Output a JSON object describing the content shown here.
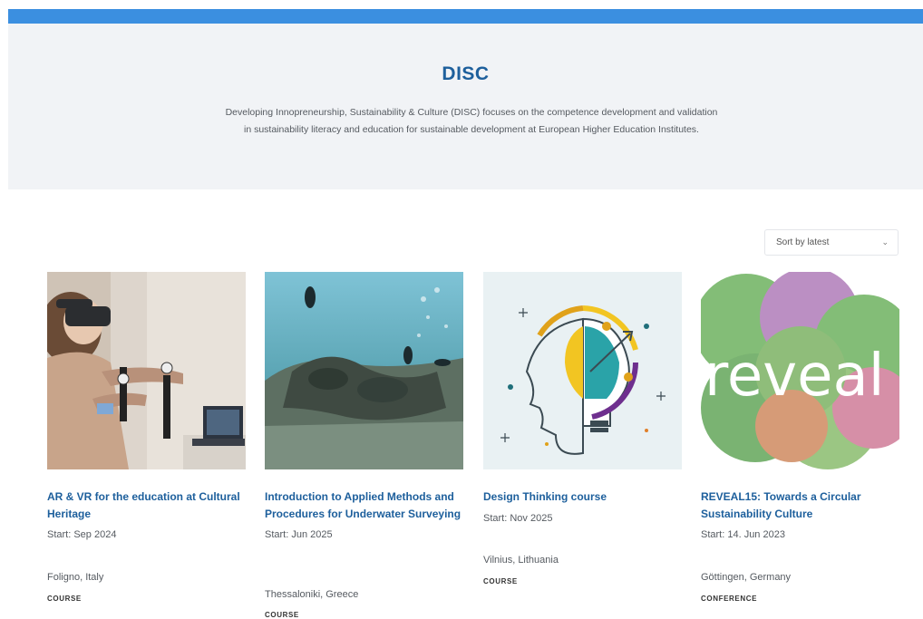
{
  "header": {
    "title": "DISC",
    "description": "Developing Innopreneurship, Sustainability & Culture (DISC) focuses on the competence development and validation in sustainability literacy and education for sustainable development at European Higher Education Institutes."
  },
  "sort": {
    "selected": "Sort by latest"
  },
  "cards": [
    {
      "title": "AR & VR for the education at Cultural Heritage",
      "start": "Start: Sep 2024",
      "location": "Foligno, Italy",
      "type": "COURSE"
    },
    {
      "title": "Introduction to Applied Methods and Procedures for Underwater Surveying",
      "start": "Start: Jun 2025",
      "location": "Thessaloniki, Greece",
      "type": "COURSE"
    },
    {
      "title": "Design Thinking course",
      "start": "Start: Nov 2025",
      "location": "Vilnius, Lithuania",
      "type": "COURSE"
    },
    {
      "title": "REVEAL15: Towards a Circular Sustainability Culture",
      "start": "Start: 14. Jun 2023",
      "location": "Göttingen, Germany",
      "type": "CONFERENCE"
    }
  ],
  "logo_text": "reveal",
  "colors": {
    "accent": "#1d5f9c",
    "topbar": "#3b8fe0",
    "hero_bg": "#f1f3f6"
  }
}
